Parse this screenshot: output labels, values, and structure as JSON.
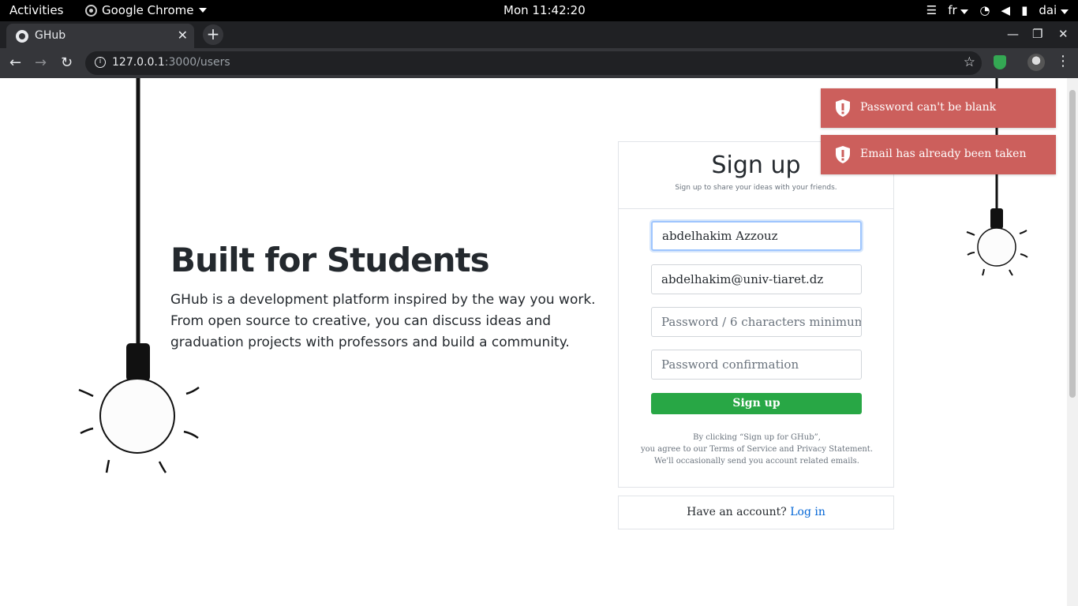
{
  "topbar": {
    "activities": "Activities",
    "app_name": "Google Chrome",
    "clock": "Mon 11:42:20",
    "lang": "fr",
    "user": "dai"
  },
  "browser": {
    "tab_title": "GHub",
    "url_host": "127.0.0.1",
    "url_rest": ":3000/users"
  },
  "hero": {
    "title": "Built for Students",
    "lines": [
      "GHub is a development platform inspired by the way you work.",
      "From open source to creative, you can discuss ideas and",
      "graduation projects with professors and build a community."
    ]
  },
  "signup": {
    "title": "Sign up",
    "subtitle": "Sign up to share your ideas with your friends.",
    "name_value": "abdelhakim Azzouz",
    "email_value": "abdelhakim@univ-tiaret.dz",
    "password_placeholder": "Password / 6 characters minimum",
    "confirm_placeholder": "Password confirmation",
    "button": "Sign up",
    "legal": [
      "By clicking “Sign up for GHub”,",
      "you agree to our Terms of Service and Privacy Statement.",
      "We'll occasionally send you account related emails."
    ],
    "have_account": "Have an account?",
    "login_link": "Log in"
  },
  "toasts": [
    {
      "message": "Password can't be blank"
    },
    {
      "message": "Email has already been taken"
    }
  ],
  "colors": {
    "toast_bg": "#cc5f5c",
    "button_green": "#28a745",
    "link_blue": "#0366d6"
  }
}
